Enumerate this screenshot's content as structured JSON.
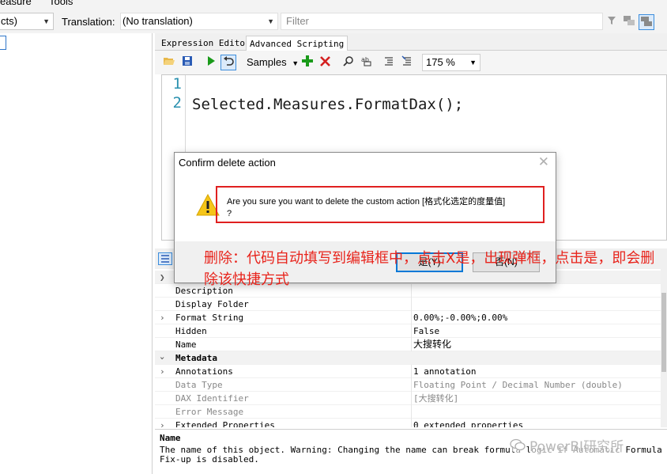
{
  "menu": {
    "items": [
      "easure",
      "Tools"
    ]
  },
  "toolbar": {
    "perspective_value": "cts)",
    "translation_label": "Translation:",
    "translation_value": "(No translation)",
    "filter_placeholder": "Filter"
  },
  "tabs": [
    {
      "label": "Expression Editor",
      "active": false
    },
    {
      "label": "Advanced Scripting",
      "active": true
    }
  ],
  "script_toolbar": {
    "samples_label": "Samples",
    "zoom_value": "175 %"
  },
  "editor": {
    "line_numbers": [
      "1",
      "2"
    ],
    "code_line": "Selected.Measures.FormatDax();"
  },
  "properties": {
    "rows": [
      {
        "name": "Description",
        "value": ""
      },
      {
        "name": "Display Folder",
        "value": ""
      },
      {
        "name": "Format String",
        "value": "0.00%;-0.00%;0.00%"
      },
      {
        "name": "Hidden",
        "value": "False"
      },
      {
        "name": "Name",
        "value": "大搜转化"
      },
      {
        "name": "Metadata",
        "value": ""
      },
      {
        "name": "Annotations",
        "value": "1 annotation"
      },
      {
        "name": "Data Type",
        "value": "Floating Point / Decimal Number (double)"
      },
      {
        "name": "DAX Identifier",
        "value": "[大搜转化]"
      },
      {
        "name": "Error Message",
        "value": ""
      },
      {
        "name": "Extended Properties",
        "value": "0 extended properties"
      }
    ]
  },
  "description_panel": {
    "title": "Name",
    "text": "The name of this object. Warning: Changing the name can break formula logic if Automatic Formula Fix-up is disabled."
  },
  "dialog": {
    "title": "Confirm delete action",
    "message_line1": "Are you sure you want to delete the custom action [格式化选定的度量值]",
    "message_line2": "?",
    "yes_button": "是(Y)",
    "no_button": "否(N)"
  },
  "annotation": {
    "text": "删除：代码自动填写到编辑框中，点击X是，出现弹框，点击是，即会删除该快捷方式"
  },
  "watermark": {
    "text": "PowerBI研究所"
  },
  "colors": {
    "accent": "#0078d7",
    "annotation_red": "#e8231b",
    "run_green": "#1a9a1a",
    "delete_red": "#d42020",
    "line_number_blue": "#2b91af"
  }
}
